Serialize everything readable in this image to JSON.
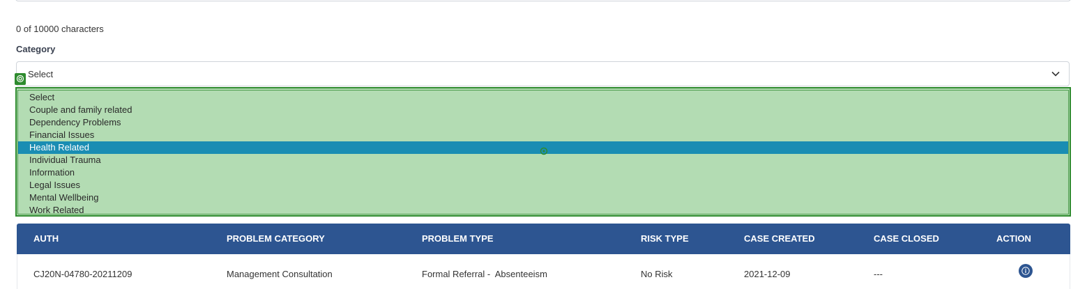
{
  "form": {
    "char_count": "0 of 10000 characters",
    "category_label": "Category",
    "category_value": "Select"
  },
  "dropdown": {
    "options": [
      {
        "label": "Select"
      },
      {
        "label": "Couple and family related"
      },
      {
        "label": "Dependency Problems"
      },
      {
        "label": "Financial Issues"
      },
      {
        "label": "Health Related"
      },
      {
        "label": "Individual Trauma"
      },
      {
        "label": "Information"
      },
      {
        "label": "Legal Issues"
      },
      {
        "label": "Mental Wellbeing"
      },
      {
        "label": "Work Related"
      }
    ],
    "selected_label": "Health Related",
    "highlight_color": "#b3dcb3",
    "selected_color": "#1a8db3"
  },
  "table": {
    "header_color": "#2d5591",
    "columns": [
      "AUTH",
      "PROBLEM CATEGORY",
      "PROBLEM TYPE",
      "RISK TYPE",
      "CASE CREATED",
      "CASE CLOSED",
      "ACTION"
    ],
    "rows": [
      {
        "auth": "CJ20N-04780-20211209",
        "problem_category": "Management Consultation",
        "problem_type": "Formal Referral -  Absenteeism",
        "risk_type": "No Risk",
        "case_created": "2021-12-09",
        "case_closed": "---",
        "action_icon": "info-icon"
      }
    ]
  }
}
